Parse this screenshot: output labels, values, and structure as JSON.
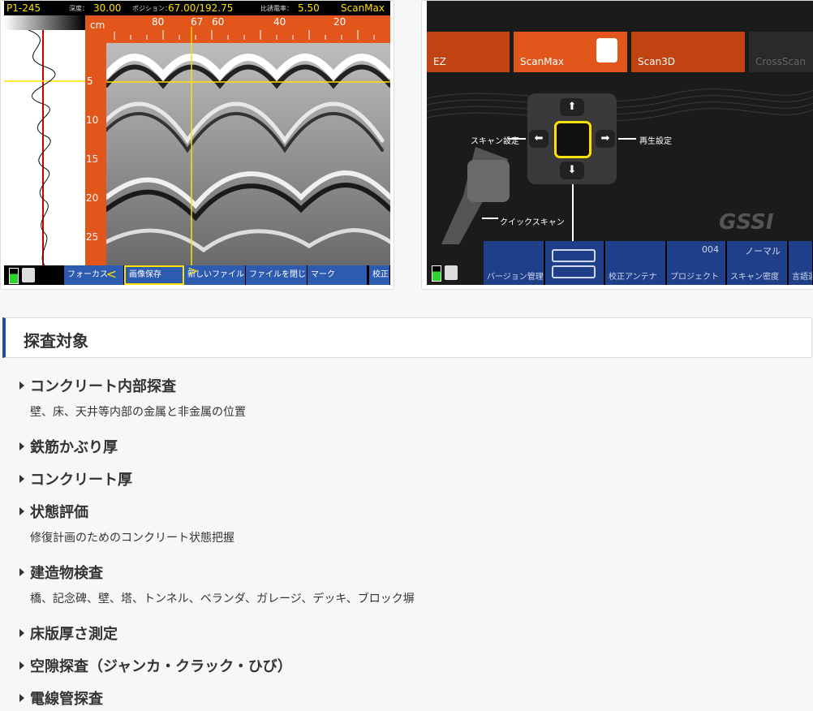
{
  "left_screen": {
    "file_id": "P1-245",
    "depth_label": "深度：",
    "depth_value": "30.00",
    "position_label": "ポジション：",
    "position_value": "67.00/192.75",
    "dielectric_label": "比誘電率：",
    "dielectric_value": "5.50",
    "mode": "ScanMax",
    "unit": "cm",
    "h_ticks": [
      "80",
      "67",
      "60",
      "40",
      "20"
    ],
    "v_ticks": [
      "5",
      "10",
      "15",
      "20",
      "25"
    ],
    "buttons": [
      "フォーカス",
      "画像保存",
      "新しいファイル",
      "ファイルを閉じる",
      "マーク",
      "校正"
    ]
  },
  "right_screen": {
    "modes": [
      "EZ",
      "ScanMax",
      "Scan3D",
      "CrossScan"
    ],
    "left_label": "スキャン設定",
    "right_label": "再生設定",
    "quick_label": "クイックスキャン",
    "brand": "GSSI",
    "bottom": [
      {
        "label": "バージョン管理",
        "top": ""
      },
      {
        "label": "",
        "top": ""
      },
      {
        "label": "校正アンテナ",
        "top": ""
      },
      {
        "label": "プロジェクト",
        "top": "004"
      },
      {
        "label": "スキャン密度",
        "top": "ノーマル"
      },
      {
        "label": "言語選",
        "top": ""
      }
    ]
  },
  "section": {
    "title": "探査対象",
    "items": [
      {
        "title": "コンクリート内部探査",
        "desc": "壁、床、天井等内部の金属と非金属の位置"
      },
      {
        "title": "鉄筋かぶり厚",
        "desc": ""
      },
      {
        "title": "コンクリート厚",
        "desc": ""
      },
      {
        "title": "状態評価",
        "desc": "修復計画のためのコンクリート状態把握"
      },
      {
        "title": "建造物検査",
        "desc": "橋、記念碑、壁、塔、トンネル、ベランダ、ガレージ、デッキ、ブロック塀"
      },
      {
        "title": "床版厚さ測定",
        "desc": ""
      },
      {
        "title": "空隙探査（ジャンカ・クラック・ひび）",
        "desc": ""
      },
      {
        "title": "電線管探査",
        "desc": ""
      }
    ]
  },
  "colors": {
    "accent": "#1d4f9e",
    "device_orange": "#e2561b",
    "device_blue": "#2d5bb0",
    "highlight": "#ffe000"
  }
}
